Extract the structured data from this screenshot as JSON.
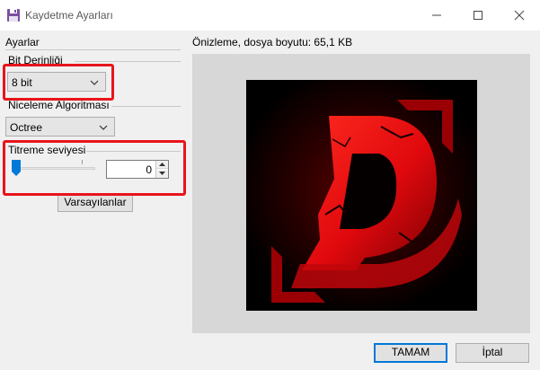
{
  "window": {
    "title": "Kaydetme Ayarları",
    "icon": "save-disk-icon",
    "controls": [
      "minimize-icon",
      "maximize-icon",
      "close-icon"
    ]
  },
  "settings": {
    "section_label": "Ayarlar",
    "bit_depth": {
      "label": "Bit Derinliği",
      "value": "8 bit"
    },
    "quantization": {
      "label": "Niceleme Algoritması",
      "value": "Octree"
    },
    "dithering": {
      "label": "Titreme seviyesi",
      "slider_value": 0,
      "value": "0"
    },
    "defaults_button": "Varsayılanlar"
  },
  "preview": {
    "label": "Önizleme, dosya boyutu: 65,1 KB",
    "image": "red-letter-d-logo"
  },
  "buttons": {
    "ok": "TAMAM",
    "cancel": "İptal"
  },
  "colors": {
    "highlight": "#e8141c",
    "accent": "#0078d7",
    "logo_red": "#e0090d"
  }
}
